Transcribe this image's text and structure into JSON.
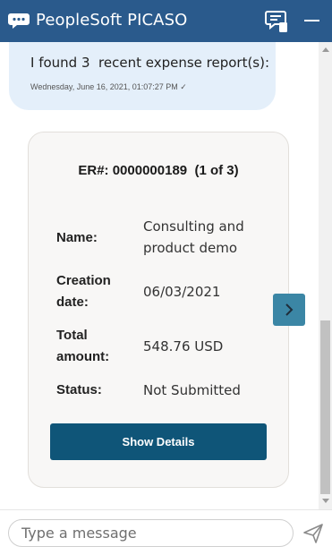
{
  "header": {
    "title": "PeopleSoft PICASO",
    "colors": {
      "background": "#2a5a8c",
      "text": "#ffffff"
    },
    "icons": {
      "logo": "chat-bubbles-icon",
      "feedback": "feedback-icon",
      "minimize": "minimize-icon"
    }
  },
  "conversation": {
    "bot_message": "I found 3  recent expense report(s):",
    "timestamp": "Wednesday, June 16, 2021, 01:07:27 PM ✓",
    "bubble_color": "#e4effa"
  },
  "card": {
    "er_heading": "ER#: 0000000189  (1 of 3)",
    "fields": {
      "name": {
        "label": "Name:",
        "value_line1": "Consulting and",
        "value_line2": "product demo"
      },
      "creation_date": {
        "label_line1": "Creation",
        "label_line2": "date:",
        "value": "06/03/2021"
      },
      "total_amount": {
        "label_line1": "Total",
        "label_line2": "amount:",
        "value": "548.76 USD"
      },
      "status": {
        "label": "Status:",
        "value": "Not Submitted"
      }
    },
    "show_details_label": "Show Details",
    "button_color": "#0f5578",
    "next_icon": "chevron-right-icon",
    "next_color": "#3b86a5"
  },
  "composer": {
    "placeholder": "Type a message",
    "value": "",
    "send_icon": "send-icon"
  }
}
